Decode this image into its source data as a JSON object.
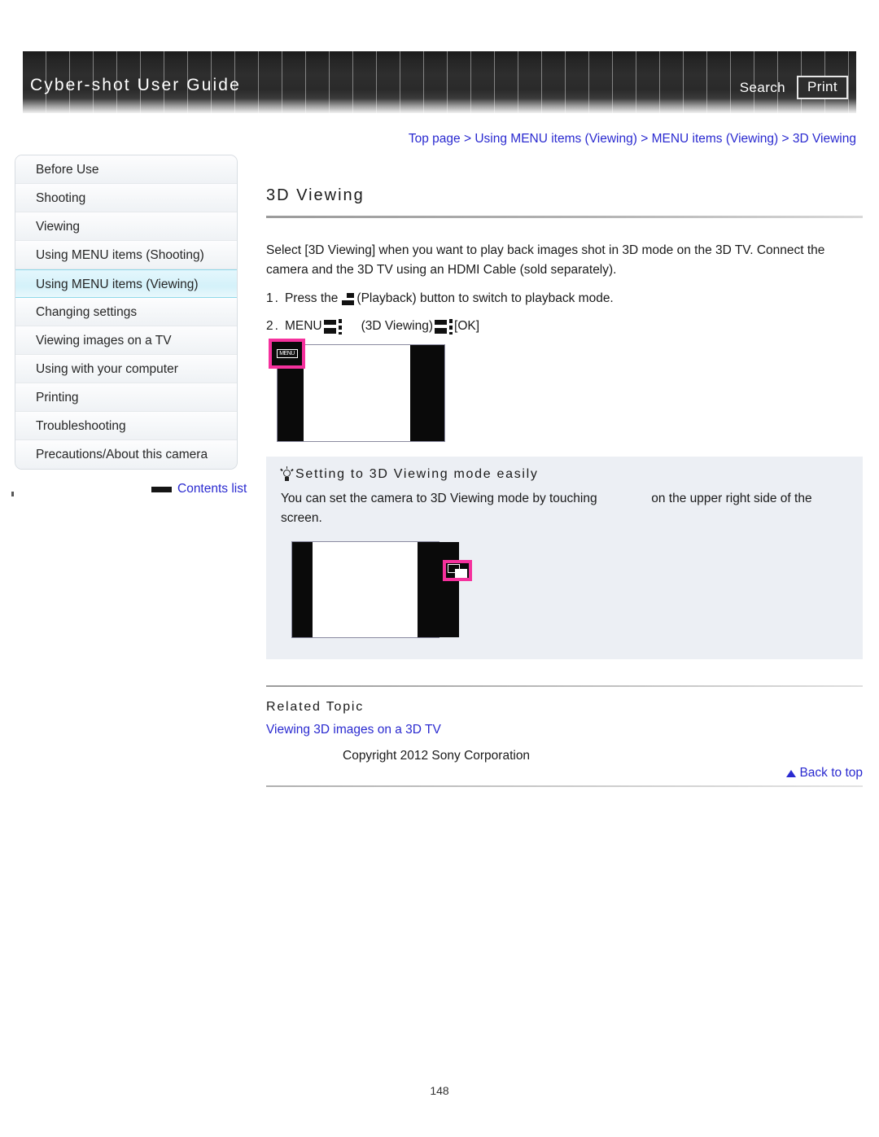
{
  "header": {
    "title": "Cyber-shot User Guide",
    "search_label": "Search",
    "print_label": "Print"
  },
  "breadcrumb": {
    "items": [
      "Top page",
      "Using MENU items (Viewing)",
      "MENU items (Viewing)",
      "3D Viewing"
    ],
    "separator": ">"
  },
  "sidebar": {
    "items": [
      {
        "label": "Before Use",
        "selected": false
      },
      {
        "label": "Shooting",
        "selected": false
      },
      {
        "label": "Viewing",
        "selected": false
      },
      {
        "label": "Using MENU items (Shooting)",
        "selected": false
      },
      {
        "label": "Using MENU items (Viewing)",
        "selected": true
      },
      {
        "label": "Changing settings",
        "selected": false
      },
      {
        "label": "Viewing images on a TV",
        "selected": false
      },
      {
        "label": "Using with your computer",
        "selected": false
      },
      {
        "label": "Printing",
        "selected": false
      },
      {
        "label": "Troubleshooting",
        "selected": false
      },
      {
        "label": "Precautions/About this camera",
        "selected": false
      }
    ],
    "contents_list_label": "Contents list"
  },
  "main": {
    "title": "3D Viewing",
    "intro": "Select [3D Viewing] when you want to play back images shot in 3D mode on the 3D TV. Connect the camera and the 3D TV using an HDMI Cable (sold separately).",
    "steps": [
      {
        "number": "1.",
        "text_before": "Press the",
        "icon": "playback-icon",
        "text_after": "(Playback) button to switch to playback mode."
      },
      {
        "number": "2.",
        "text_before": "MENU",
        "icon_1": "arrow-icon",
        "text_middle": "(3D Viewing)",
        "icon_2": "arrow-icon",
        "text_after": "[OK]"
      }
    ],
    "figure_1": {
      "name": "camera-screen-menu-button",
      "highlight_color": "#f5319d",
      "button_label": "MENU"
    },
    "tip": {
      "heading": "Setting to 3D Viewing mode easily",
      "body_before": "You can set the camera to 3D Viewing mode by touching",
      "body_after": "on the upper right side of the screen."
    },
    "figure_2": {
      "name": "camera-screen-3d-button",
      "highlight_color": "#f5319d"
    },
    "related_heading": "Related Topic",
    "related_link": "Viewing 3D images on a 3D TV"
  },
  "footer": {
    "back_to_top": "Back to top",
    "copyright": "Copyright 2012 Sony Corporation",
    "page_number": "148"
  }
}
